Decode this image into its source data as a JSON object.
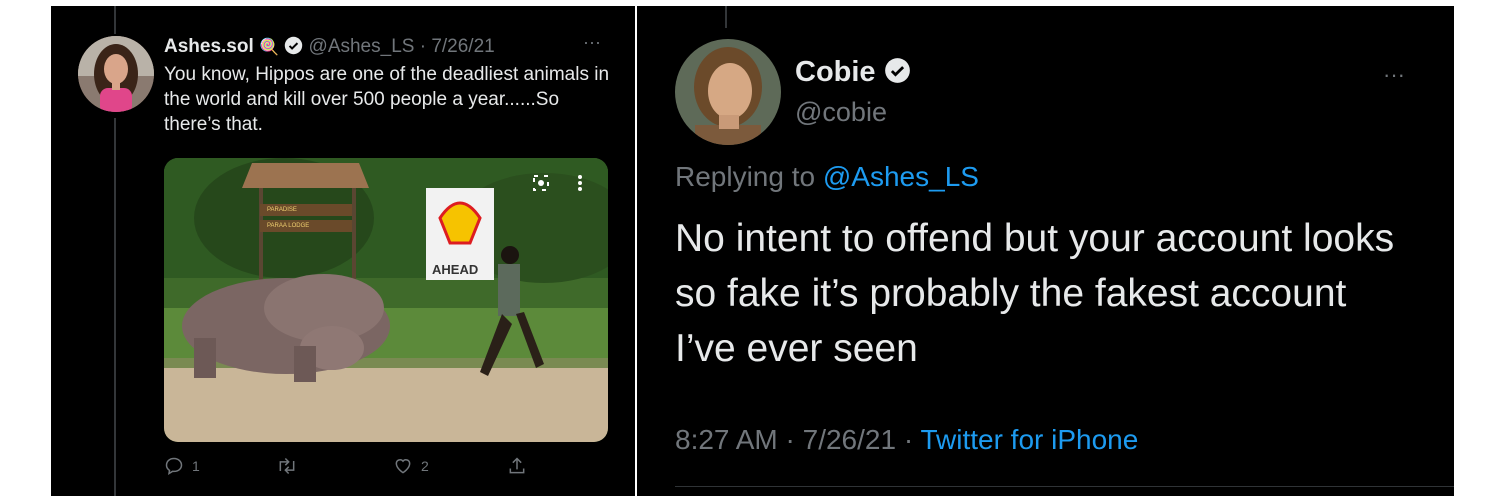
{
  "left_tweet": {
    "display_name": "Ashes.sol",
    "name_emoji": "🍭",
    "handle": "@Ashes_LS",
    "date": "7/26/21",
    "more": "···",
    "text": "You know, Hippos are one of the deadliest animals in the world and kill over 500 people a year......So there’s that.",
    "media": {
      "sign_top": "PARADISE",
      "sign_bottom": "PARAA LODGE",
      "shell_text": "AHEAD"
    },
    "actions": {
      "reply_count": "1",
      "retweet_count": "",
      "like_count": "2"
    }
  },
  "right_tweet": {
    "display_name": "Cobie",
    "handle": "@cobie",
    "more": "···",
    "replying_prefix": "Replying to ",
    "replying_handle": "@Ashes_LS",
    "text": "No intent to offend but your account looks so fake it’s probably the fakest account I’ve ever seen",
    "time": "8:27 AM",
    "date": "7/26/21",
    "separator": " · ",
    "source": "Twitter for iPhone"
  },
  "colors": {
    "background": "#000000",
    "text": "#e7e9ea",
    "muted": "#71767b",
    "link": "#1d9bf0"
  }
}
